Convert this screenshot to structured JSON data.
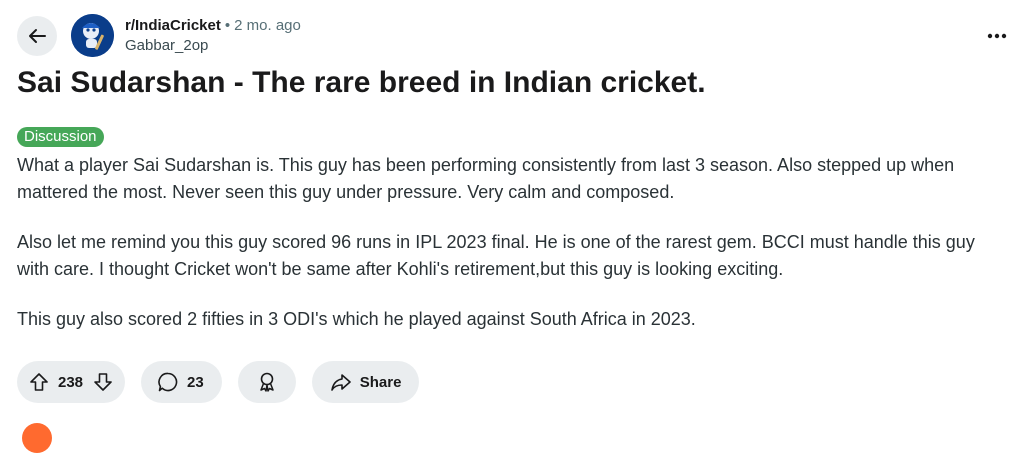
{
  "post": {
    "subreddit": "r/IndiaCricket",
    "separator": "•",
    "time_ago": "2 mo. ago",
    "author": "Gabbar_2op",
    "title": "Sai Sudarshan - The rare breed in Indian cricket.",
    "flair": "Discussion",
    "body": [
      "What a player Sai Sudarshan is. This guy has been performing consistently from last 3 season. Also stepped up when mattered the most. Never seen this guy under pressure. Very calm and composed.",
      "Also let me remind you this guy scored 96 runs in IPL 2023 final. He is one of the rarest gem. BCCI must handle this guy with care. I thought Cricket won't be same after Kohli's retirement,but this guy is looking exciting.",
      "This guy also scored 2 fifties in 3 ODI's which he played against South Africa in 2023."
    ]
  },
  "actions": {
    "upvotes": "238",
    "comments": "23",
    "share_label": "Share"
  },
  "icons": {
    "back": "arrow-left-icon",
    "more": "ellipsis-icon",
    "upvote": "arrow-up-icon",
    "downvote": "arrow-down-icon",
    "comment": "speech-bubble-icon",
    "award": "award-ribbon-icon",
    "share": "share-arrow-icon"
  },
  "colors": {
    "flair_bg": "#46a758",
    "pill_bg": "#eaedef",
    "avatar_bg": "#0a3d8a"
  }
}
